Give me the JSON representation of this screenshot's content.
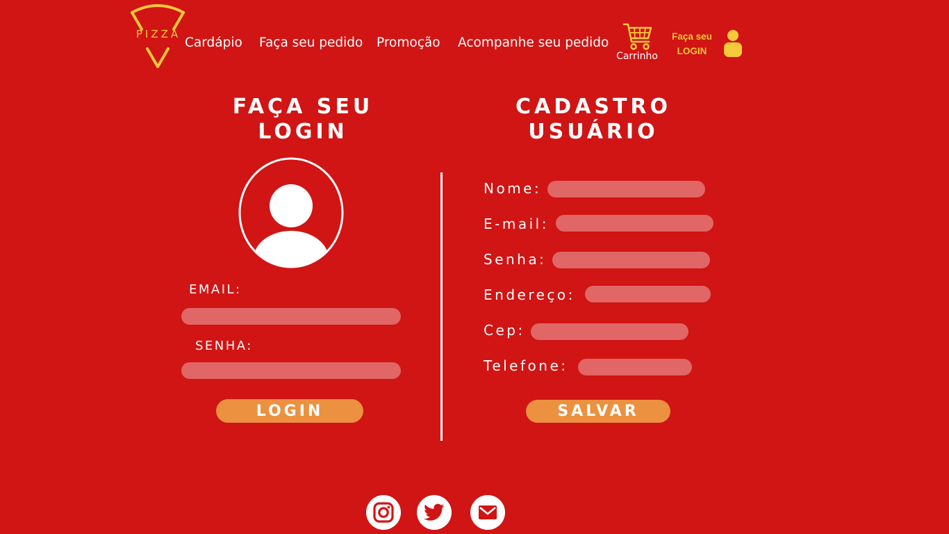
{
  "header": {
    "logo_text": "PIZZA",
    "nav": [
      "Cardápio",
      "Faça seu pedido",
      "Promoção",
      "Acompanhe seu pedido"
    ],
    "cart_label": "Carrinho",
    "login_line1": "Faça seu",
    "login_line2": "LOGIN"
  },
  "login": {
    "title_line1": "FAÇA SEU",
    "title_line2": "LOGIN",
    "email_label": "EMAIL:",
    "password_label": "SENHA:",
    "email_value": "",
    "password_value": "",
    "button": "LOGIN"
  },
  "register": {
    "title_line1": "CADASTRO",
    "title_line2": "USUÁRIO",
    "fields": [
      {
        "label": "Nome:",
        "value": ""
      },
      {
        "label": "E-mail:",
        "value": ""
      },
      {
        "label": "Senha:",
        "value": ""
      },
      {
        "label": "Endereço:",
        "value": ""
      },
      {
        "label": "Cep:",
        "value": ""
      },
      {
        "label": "Telefone:",
        "value": ""
      }
    ],
    "button": "SALVAR"
  },
  "footer": {
    "social_icons": [
      "instagram-icon",
      "twitter-icon",
      "mail-icon"
    ]
  },
  "colors": {
    "background": "#d11414",
    "accent_yellow": "#f7c93a",
    "button_orange": "#ec9140",
    "text": "#ffffff"
  }
}
